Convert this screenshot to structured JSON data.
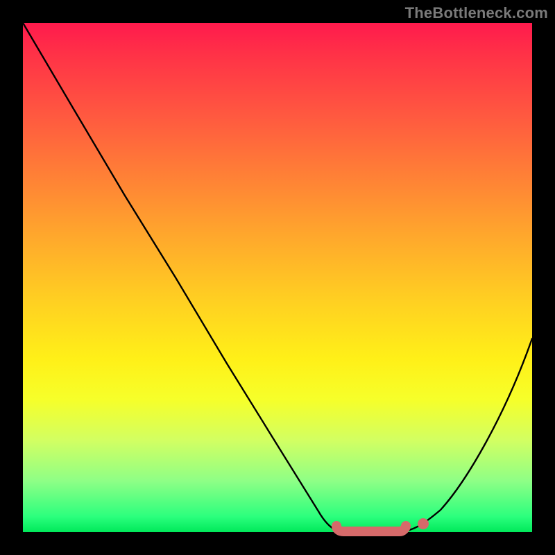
{
  "watermark": "TheBottleneck.com",
  "chart_data": {
    "type": "line",
    "title": "",
    "xlabel": "",
    "ylabel": "",
    "xlim": [
      0,
      100
    ],
    "ylim": [
      0,
      100
    ],
    "grid": false,
    "legend": false,
    "series": [
      {
        "name": "curve",
        "color": "#000000",
        "x": [
          0,
          10,
          20,
          30,
          40,
          50,
          58,
          62,
          66,
          70,
          74,
          78,
          82,
          90,
          100
        ],
        "y": [
          100,
          83,
          66,
          50,
          33,
          17,
          4,
          0,
          0,
          0,
          0,
          0,
          4,
          17,
          38
        ]
      },
      {
        "name": "flat-highlight",
        "color": "#d66a6a",
        "style": "thick-round",
        "x": [
          62,
          74
        ],
        "y": [
          0,
          0
        ]
      },
      {
        "name": "dot",
        "color": "#d66a6a",
        "style": "marker",
        "x": [
          78
        ],
        "y": [
          1
        ]
      }
    ]
  },
  "colors": {
    "gradient_top": "#ff1a4d",
    "gradient_mid": "#ffd400",
    "gradient_bottom": "#00e85a",
    "curve": "#000000",
    "highlight": "#d66a6a",
    "frame": "#000000"
  }
}
